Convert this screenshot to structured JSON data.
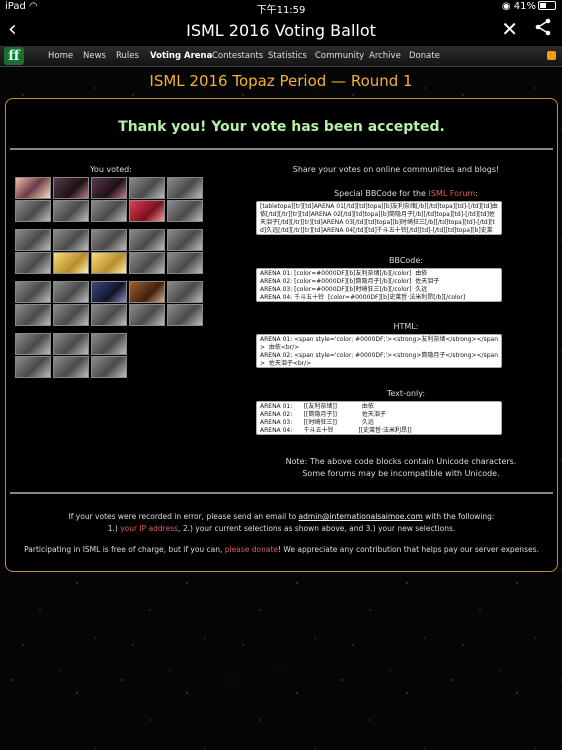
{
  "statusbar": {
    "carrier": "iPad",
    "time": "下午11:59",
    "battery": "41%"
  },
  "titlebar": {
    "title": "ISML 2016 Voting Ballot",
    "back_icon": "‹",
    "close_icon": "✕",
    "share_icon": "share"
  },
  "nav": {
    "logo": "ff",
    "items": [
      "Home",
      "News",
      "Rules",
      "Voting Arena",
      "Contestants",
      "Statistics",
      "Community",
      "Archive",
      "Donate"
    ]
  },
  "page_title": "ISML 2016 Topaz Period — Round 1",
  "thanks": "Thank you! Your vote has been accepted.",
  "you_voted": "You voted:",
  "share_heading": "Share your votes on online communities and blogs!",
  "bbcode_special": {
    "label_prefix": "Special BBCode for the ",
    "label_link": "ISML Forum",
    "label_suffix": ":",
    "content": "[tabletopa][tr][td]ARENA 01[/td][td]topa][b]友利奈绪[/b][/td]topa][td]-[/td][td]由依[/td][/tr][tr][td]ARENA 02[/td][td]topa][b]筒隐月子[/b][/td]topa][td]-[/td][td]佐天泪子[/td][/tr][tr][td]ARENA 03[/td][td]topa][b]时崎狂三[/b][/td]topa][td]-[/td][td]久远[/td][/tr][tr][td]ARENA 04[/td][td]千斗五十铃[/td][td]-[/td][td]topa][b]史莱哲·法米利昂[/b][/td]topa][/tr][tr][td]ARENA"
  },
  "bbcode": {
    "label": "BBCode:",
    "content": "ARENA 01: [color=#0000DF][b]友利奈绪[/b][/color]  由依\nARENA 02: [color=#0000DF][b]筒隐月子[/b][/color]  佐天泪子\nARENA 03: [color=#0000DF][b]时崎狂三[/b][/color]  久远\nARENA 04: 千斗五十铃  [color=#0000DF][b]史莱哲·法米利昂[/b][/color]"
  },
  "html_code": {
    "label": "HTML:",
    "content": "ARENA 01: <span style='color: #0000DF;'><strong>友利奈绪</strong></span>  由依<br/>\nARENA 02: <span style='color: #0000DF;'><strong>筒隐月子</strong></span>  佐天泪子<br/>"
  },
  "text_only": {
    "label": "Text-only:",
    "content": "ARENA 01:      [[友利奈绪]]             由依\nARENA 02:      [[筒隐月子]]             佐天泪子\nARENA 03:      [[时崎狂三]]             久远\nARENA 04:      千斗五十铃             [[史莱哲·法米利昂]]"
  },
  "note_line1": "Note: The above code blocks contain Unicode characters.",
  "note_line2": "Some forums may be incompatible with Unicode.",
  "footer": {
    "line1_prefix": "If your votes were recorded in error, please send an email to ",
    "email": "admin@internationalsaimoe.com",
    "line1_suffix": " with the following:",
    "line2_a": "1.) ",
    "ip_link": "your IP address",
    "line2_b": ", 2.) your current selections as shown above, and 3.) your new selections.",
    "line3_a": "Participating in ISML is free of charge, but if you can, ",
    "donate_link": "please donate",
    "line3_b": "! We appreciate any contribution that helps pay our server expenses."
  }
}
